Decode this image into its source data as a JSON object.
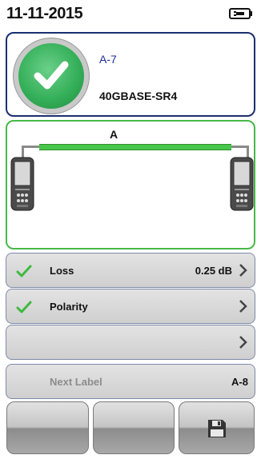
{
  "status": {
    "date": "11-11-2015",
    "battery_icon": "battery-plug-icon"
  },
  "result": {
    "status_icon": "check-circle-icon",
    "label": "A-7",
    "cable_type": "40GBASE-SR4"
  },
  "diagram": {
    "fiber_label": "A",
    "fiber_color": "#47c64a",
    "left_device_icon": "tester-device-icon",
    "right_device_icon": "tester-device-icon"
  },
  "rows": {
    "loss": {
      "label": "Loss",
      "value": "0.25 dB",
      "status_icon": "check-icon"
    },
    "polarity": {
      "label": "Polarity",
      "value": "",
      "status_icon": "check-icon"
    },
    "empty": {
      "label": "",
      "value": ""
    },
    "next_label": {
      "label": "Next Label",
      "value": "A-8"
    }
  },
  "softkeys": {
    "save_icon": "save-icon"
  },
  "colors": {
    "pass_green": "#36b05a",
    "header_blue": "#1a2f6e",
    "label_blue": "#1c2f9a"
  }
}
